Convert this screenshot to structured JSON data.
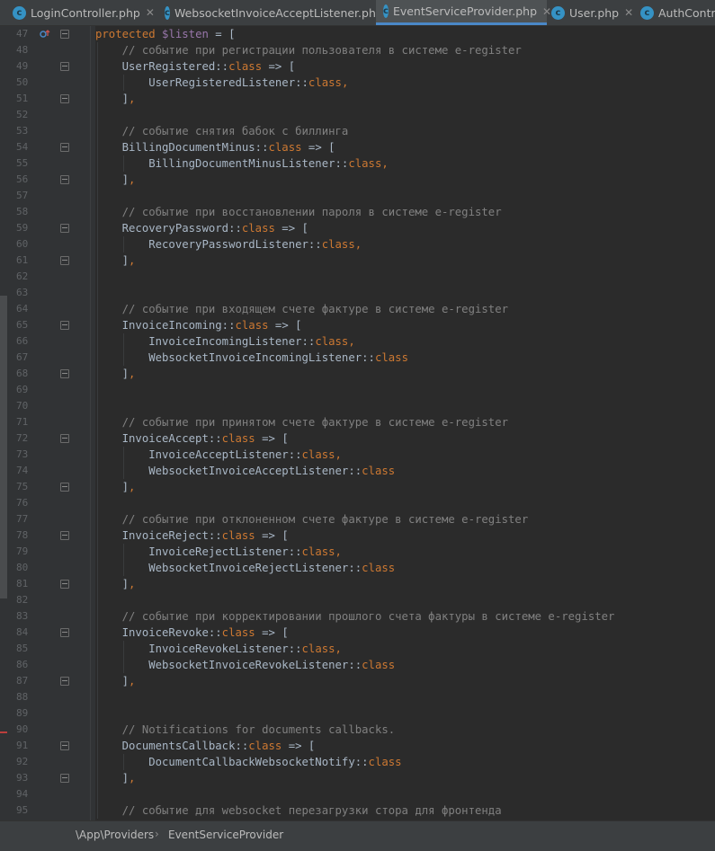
{
  "tabs": [
    {
      "label": "LoginController.php",
      "active": false,
      "icon": "php-class-icon"
    },
    {
      "label": "WebsocketInvoiceAcceptListener.php",
      "active": false,
      "icon": "php-class-icon"
    },
    {
      "label": "EventServiceProvider.php",
      "active": true,
      "icon": "php-class-icon"
    },
    {
      "label": "User.php",
      "active": false,
      "icon": "php-class-icon"
    },
    {
      "label": "AuthControll",
      "active": false,
      "icon": "php-class-icon"
    }
  ],
  "tab_icon_letter": "c",
  "tab_close_glyph": "✕",
  "lines": [
    {
      "n": "47",
      "t": [
        [
          "kw",
          "protected "
        ],
        [
          "var",
          "$listen"
        ],
        [
          "p",
          " = ["
        ]
      ]
    },
    {
      "n": "48",
      "t": [
        [
          "cm",
          "    // событие при регистрации пользователя в системе e-register"
        ]
      ]
    },
    {
      "n": "49",
      "t": [
        [
          "p",
          "    UserRegistered::"
        ],
        [
          "kw",
          "class"
        ],
        [
          "p",
          " => ["
        ]
      ]
    },
    {
      "n": "50",
      "t": [
        [
          "p",
          "        UserRegisteredListener::"
        ],
        [
          "kw",
          "class"
        ],
        [
          "kw",
          ","
        ]
      ]
    },
    {
      "n": "51",
      "t": [
        [
          "p",
          "    ]"
        ],
        [
          "kw",
          ","
        ]
      ]
    },
    {
      "n": "52",
      "t": []
    },
    {
      "n": "53",
      "t": [
        [
          "cm",
          "    // событие снятия бабок с биллинга"
        ]
      ]
    },
    {
      "n": "54",
      "t": [
        [
          "p",
          "    BillingDocumentMinus::"
        ],
        [
          "kw",
          "class"
        ],
        [
          "p",
          " => ["
        ]
      ]
    },
    {
      "n": "55",
      "t": [
        [
          "p",
          "        BillingDocumentMinusListener::"
        ],
        [
          "kw",
          "class"
        ],
        [
          "kw",
          ","
        ]
      ]
    },
    {
      "n": "56",
      "t": [
        [
          "p",
          "    ]"
        ],
        [
          "kw",
          ","
        ]
      ]
    },
    {
      "n": "57",
      "t": []
    },
    {
      "n": "58",
      "t": [
        [
          "cm",
          "    // событие при восстановлении пароля в системе e-register"
        ]
      ]
    },
    {
      "n": "59",
      "t": [
        [
          "p",
          "    RecoveryPassword::"
        ],
        [
          "kw",
          "class"
        ],
        [
          "p",
          " => ["
        ]
      ]
    },
    {
      "n": "60",
      "t": [
        [
          "p",
          "        RecoveryPasswordListener::"
        ],
        [
          "kw",
          "class"
        ],
        [
          "kw",
          ","
        ]
      ]
    },
    {
      "n": "61",
      "t": [
        [
          "p",
          "    ]"
        ],
        [
          "kw",
          ","
        ]
      ]
    },
    {
      "n": "62",
      "t": []
    },
    {
      "n": "63",
      "t": []
    },
    {
      "n": "64",
      "t": [
        [
          "cm",
          "    // событие при входящем счете фактуре в системе e-register"
        ]
      ]
    },
    {
      "n": "65",
      "t": [
        [
          "p",
          "    InvoiceIncoming::"
        ],
        [
          "kw",
          "class"
        ],
        [
          "p",
          " => ["
        ]
      ]
    },
    {
      "n": "66",
      "t": [
        [
          "p",
          "        InvoiceIncomingListener::"
        ],
        [
          "kw",
          "class"
        ],
        [
          "kw",
          ","
        ]
      ]
    },
    {
      "n": "67",
      "t": [
        [
          "p",
          "        WebsocketInvoiceIncomingListener::"
        ],
        [
          "kw",
          "class"
        ]
      ]
    },
    {
      "n": "68",
      "t": [
        [
          "p",
          "    ]"
        ],
        [
          "kw",
          ","
        ]
      ]
    },
    {
      "n": "69",
      "t": []
    },
    {
      "n": "70",
      "t": []
    },
    {
      "n": "71",
      "t": [
        [
          "cm",
          "    // событие при принятом счете фактуре в системе e-register"
        ]
      ]
    },
    {
      "n": "72",
      "t": [
        [
          "p",
          "    InvoiceAccept::"
        ],
        [
          "kw",
          "class"
        ],
        [
          "p",
          " => ["
        ]
      ]
    },
    {
      "n": "73",
      "t": [
        [
          "p",
          "        InvoiceAcceptListener::"
        ],
        [
          "kw",
          "class"
        ],
        [
          "kw",
          ","
        ]
      ]
    },
    {
      "n": "74",
      "t": [
        [
          "p",
          "        WebsocketInvoiceAcceptListener::"
        ],
        [
          "kw",
          "class"
        ]
      ]
    },
    {
      "n": "75",
      "t": [
        [
          "p",
          "    ]"
        ],
        [
          "kw",
          ","
        ]
      ]
    },
    {
      "n": "76",
      "t": []
    },
    {
      "n": "77",
      "t": [
        [
          "cm",
          "    // событие при отклоненном счете фактуре в системе e-register"
        ]
      ]
    },
    {
      "n": "78",
      "t": [
        [
          "p",
          "    InvoiceReject::"
        ],
        [
          "kw",
          "class"
        ],
        [
          "p",
          " => ["
        ]
      ]
    },
    {
      "n": "79",
      "t": [
        [
          "p",
          "        InvoiceRejectListener::"
        ],
        [
          "kw",
          "class"
        ],
        [
          "kw",
          ","
        ]
      ]
    },
    {
      "n": "80",
      "t": [
        [
          "p",
          "        WebsocketInvoiceRejectListener::"
        ],
        [
          "kw",
          "class"
        ]
      ]
    },
    {
      "n": "81",
      "t": [
        [
          "p",
          "    ]"
        ],
        [
          "kw",
          ","
        ]
      ]
    },
    {
      "n": "82",
      "t": []
    },
    {
      "n": "83",
      "t": [
        [
          "cm",
          "    // событие при корректировании прошлого счета фактуры в системе e-register"
        ]
      ]
    },
    {
      "n": "84",
      "t": [
        [
          "p",
          "    InvoiceRevoke::"
        ],
        [
          "kw",
          "class"
        ],
        [
          "p",
          " => ["
        ]
      ]
    },
    {
      "n": "85",
      "t": [
        [
          "p",
          "        InvoiceRevokeListener::"
        ],
        [
          "kw",
          "class"
        ],
        [
          "kw",
          ","
        ]
      ]
    },
    {
      "n": "86",
      "t": [
        [
          "p",
          "        WebsocketInvoiceRevokeListener::"
        ],
        [
          "kw",
          "class"
        ]
      ]
    },
    {
      "n": "87",
      "t": [
        [
          "p",
          "    ]"
        ],
        [
          "kw",
          ","
        ]
      ]
    },
    {
      "n": "88",
      "t": []
    },
    {
      "n": "89",
      "t": []
    },
    {
      "n": "90",
      "t": [
        [
          "cm",
          "    // Notifications for documents callbacks."
        ]
      ]
    },
    {
      "n": "91",
      "t": [
        [
          "p",
          "    DocumentsCallback::"
        ],
        [
          "kw",
          "class"
        ],
        [
          "p",
          " => ["
        ]
      ]
    },
    {
      "n": "92",
      "t": [
        [
          "p",
          "        DocumentCallbackWebsocketNotify::"
        ],
        [
          "kw",
          "class"
        ]
      ]
    },
    {
      "n": "93",
      "t": [
        [
          "p",
          "    ]"
        ],
        [
          "kw",
          ","
        ]
      ]
    },
    {
      "n": "94",
      "t": []
    },
    {
      "n": "95",
      "t": [
        [
          "cm",
          "    // событие для websocket перезагрузки стора для фронтенда"
        ]
      ]
    }
  ],
  "fold_lines": [
    "47",
    "49",
    "51",
    "54",
    "56",
    "59",
    "61",
    "65",
    "68",
    "72",
    "75",
    "78",
    "81",
    "84",
    "87",
    "91",
    "93"
  ],
  "breadcrumbs": [
    "\\App\\Providers",
    "EventServiceProvider"
  ],
  "breadcrumb_separator": "›",
  "colors": {
    "keyword": "#cc7832",
    "variable": "#9876aa",
    "comment": "#808080",
    "text": "#a9b7c6",
    "background": "#2b2b2b",
    "accent": "#4a88c7"
  }
}
